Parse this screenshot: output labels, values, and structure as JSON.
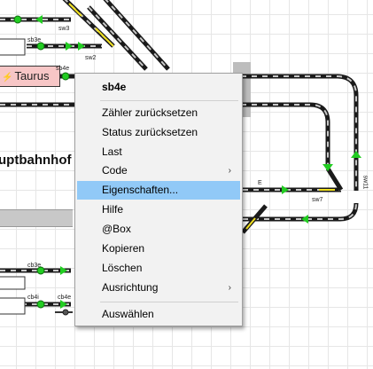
{
  "layout_labels": {
    "track_labels": [
      "sb3e",
      "sw3",
      "sw2",
      "sb4e",
      "E",
      "sw7",
      "sw11",
      "cb3e",
      "cb4i",
      "cb4e"
    ],
    "locomotive": "Taurus",
    "station_title": "uptbahnhof"
  },
  "context_menu": {
    "title": "sb4e",
    "items": [
      {
        "label": "Zähler zurücksetzen"
      },
      {
        "label": "Status zurücksetzen"
      },
      {
        "label": "Last"
      },
      {
        "label": "Code",
        "submenu": true
      },
      {
        "label": "Eigenschaften...",
        "highlighted": true
      },
      {
        "label": "Hilfe"
      },
      {
        "label": "@Box"
      },
      {
        "label": "Kopieren"
      },
      {
        "label": "Löschen"
      },
      {
        "label": "Ausrichtung",
        "submenu": true
      },
      {
        "label": "Auswählen"
      }
    ],
    "submenu_arrow": "›"
  },
  "colors": {
    "track": "#1a1a1a",
    "track_dash": "#c8c8c8",
    "occupied_dash": "#f0e020",
    "signal_green": "#22cc22",
    "highlight": "#91c9f7",
    "locomotive_block": "#f7c6c6"
  }
}
